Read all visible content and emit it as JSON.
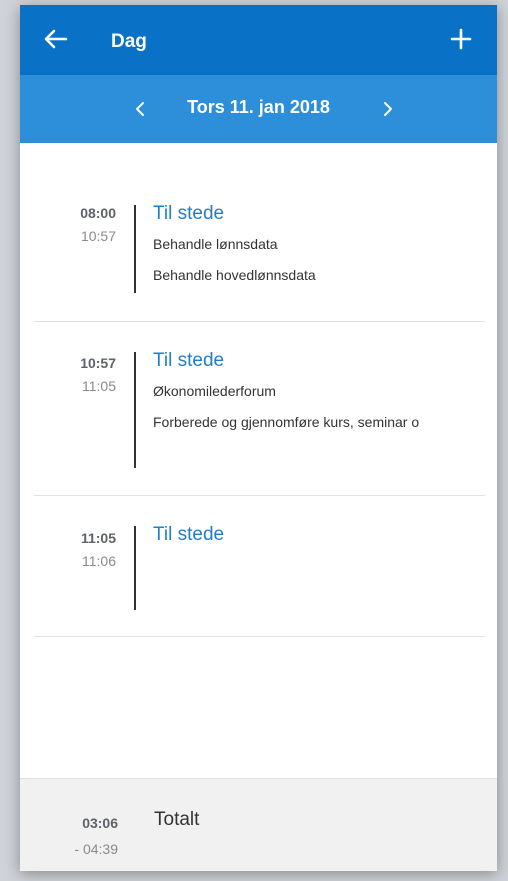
{
  "appbar": {
    "title": "Dag",
    "back_icon": "arrow-left-icon",
    "add_icon": "plus-icon",
    "color": "#0a72c6"
  },
  "datebar": {
    "date": "Tors 11. jan 2018",
    "prev_icon": "chevron-left-icon",
    "next_icon": "chevron-right-icon",
    "color": "#2d8fda"
  },
  "entries": [
    {
      "start": "08:00",
      "end": "10:57",
      "status": "Til stede",
      "line1": "Behandle lønnsdata",
      "line2": "Behandle hovedlønnsdata"
    },
    {
      "start": "10:57",
      "end": "11:05",
      "status": "Til stede",
      "line1": "Økonomilederforum",
      "line2": "Forberede og gjennomføre kurs, seminar o"
    },
    {
      "start": "11:05",
      "end": "11:06",
      "status": "Til stede",
      "line1": "",
      "line2": ""
    }
  ],
  "total": {
    "time": "03:06",
    "range": "- 04:39",
    "label": "Totalt"
  }
}
